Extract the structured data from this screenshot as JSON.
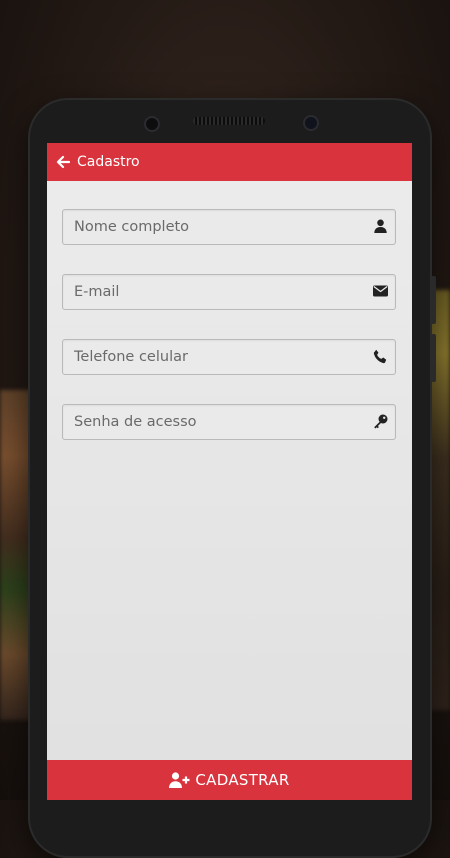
{
  "appbar": {
    "title": "Cadastro",
    "back_icon": "arrow-left-icon"
  },
  "form": {
    "fields": [
      {
        "placeholder": "Nome completo",
        "value": "",
        "icon": "user-icon"
      },
      {
        "placeholder": "E-mail",
        "value": "",
        "icon": "envelope-icon"
      },
      {
        "placeholder": "Telefone celular",
        "value": "",
        "icon": "phone-icon"
      },
      {
        "placeholder": "Senha de acesso",
        "value": "",
        "icon": "key-icon"
      }
    ]
  },
  "submit": {
    "label": "CADASTRAR",
    "icon": "user-plus-icon"
  },
  "colors": {
    "accent": "#d9343d",
    "screen_bg": "#e6e6e6",
    "field_border": "#b9b9b9"
  }
}
